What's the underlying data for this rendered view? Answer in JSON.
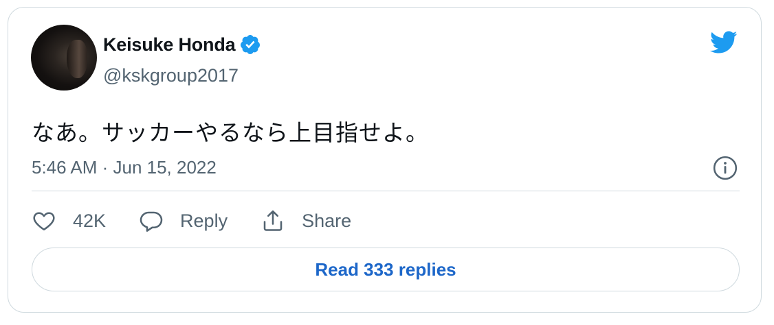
{
  "tweet": {
    "author_name": "Keisuke Honda",
    "author_handle": "@kskgroup2017",
    "text": "なあ。サッカーやるなら上目指せよ。",
    "timestamp": "5:46 AM · Jun 15, 2022",
    "verified": true
  },
  "actions": {
    "like_count": "42K",
    "reply_label": "Reply",
    "share_label": "Share"
  },
  "read_replies_label": "Read 333 replies",
  "colors": {
    "twitter_blue": "#1d9bf0",
    "verified_blue": "#1d9bf0",
    "link_blue": "#1d67c9",
    "secondary_text": "#536471",
    "border": "#cfd9de"
  },
  "icons": [
    "avatar",
    "verified-badge-icon",
    "twitter-bird-icon",
    "info-icon",
    "heart-icon",
    "reply-bubble-icon",
    "share-icon"
  ]
}
